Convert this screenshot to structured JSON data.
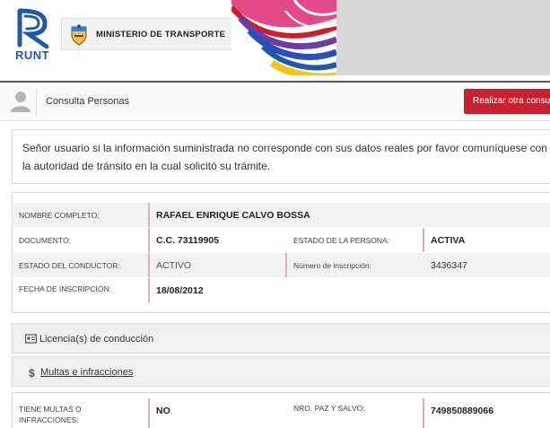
{
  "header": {
    "logo_text": "RUNT",
    "ministry": "MINISTERIO DE TRANSPORTE",
    "accent_colors": [
      "#1f5aa6",
      "#c9202f",
      "#f5c518",
      "#6b3fa0"
    ]
  },
  "toolbar": {
    "title": "Consulta Personas",
    "action_button": "Realizar otra consult"
  },
  "notice": {
    "line1": "Señor usuario si la información suministrada no corresponde con sus datos reales por favor comuníquese con",
    "line2": "la autoridad de tránsito en la cual solicitó su trámite."
  },
  "person": {
    "nombre_label": "NOMBRE COMPLETO:",
    "nombre_value": "RAFAEL ENRIQUE CALVO BOSSA",
    "documento_label": "DOCUMENTO:",
    "documento_value": "C.C. 73119905",
    "estado_persona_label": "ESTADO DE LA PERSONA:",
    "estado_persona_value": "ACTIVA",
    "estado_conductor_label": "ESTADO DEL CONDUCTOR:",
    "estado_conductor_value": "ACTIVO",
    "numero_inscripcion_label": "Número de inscripción:",
    "numero_inscripcion_value": "3436347",
    "fecha_inscripcion_label": "FECHA DE INSCRIPCIÓN:",
    "fecha_inscripcion_value": "18/08/2012"
  },
  "sections": {
    "licencias": "Licencia(s) de conducción",
    "multas": "Multas e infracciones"
  },
  "multas": {
    "tiene_label_1": "TIENE MULTAS O",
    "tiene_label_2": "INFRACCIONES:",
    "tiene_value": "NO",
    "paz_label": "NRO. PAZ Y SALVO:",
    "paz_value": "749850889066"
  }
}
